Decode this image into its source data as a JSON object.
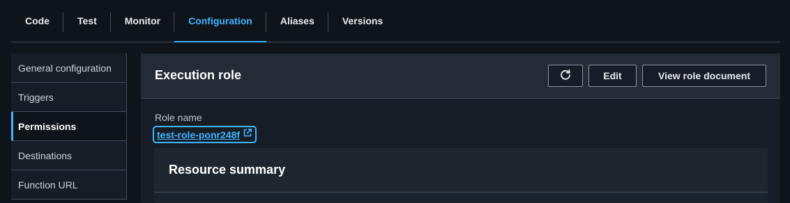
{
  "tabs": [
    {
      "label": "Code",
      "active": false
    },
    {
      "label": "Test",
      "active": false
    },
    {
      "label": "Monitor",
      "active": false
    },
    {
      "label": "Configuration",
      "active": true
    },
    {
      "label": "Aliases",
      "active": false
    },
    {
      "label": "Versions",
      "active": false
    }
  ],
  "sidebar": {
    "items": [
      {
        "label": "General configuration",
        "active": false
      },
      {
        "label": "Triggers",
        "active": false
      },
      {
        "label": "Permissions",
        "active": true
      },
      {
        "label": "Destinations",
        "active": false
      },
      {
        "label": "Function URL",
        "active": false
      }
    ]
  },
  "execution_role": {
    "title": "Execution role",
    "refresh_icon": "refresh-icon",
    "edit_label": "Edit",
    "view_doc_label": "View role document",
    "role_name_label": "Role name",
    "role_name": "test-role-ponr248f",
    "external_icon": "external-link-icon"
  },
  "resource_summary": {
    "title": "Resource summary"
  },
  "colors": {
    "background": "#0f141a",
    "accent": "#42b4ff",
    "panel": "#161d26",
    "border": "#414d5c"
  }
}
